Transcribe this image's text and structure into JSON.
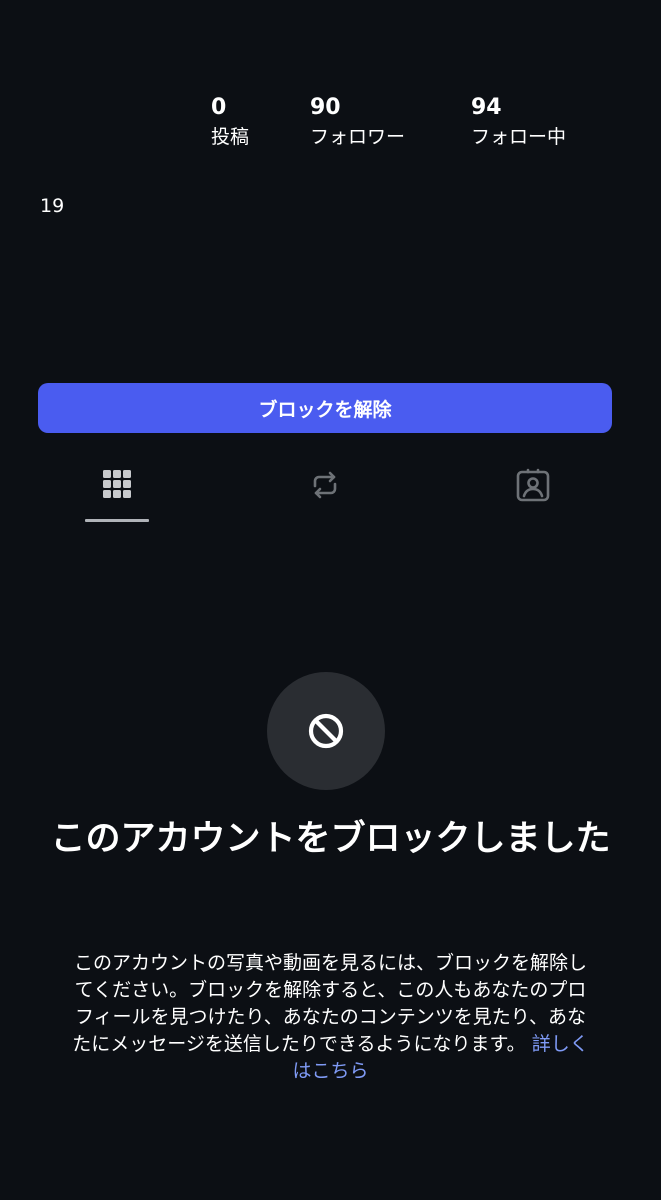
{
  "profile": {
    "stats": [
      {
        "value": "0",
        "label": "投稿"
      },
      {
        "value": "90",
        "label": "フォロワー"
      },
      {
        "value": "94",
        "label": "フォロー中"
      }
    ],
    "age": "19"
  },
  "unblock_button": {
    "label": "ブロックを解除"
  },
  "tabs": [
    {
      "icon": "grid-icon",
      "selected": true
    },
    {
      "icon": "repost-icon",
      "selected": false
    },
    {
      "icon": "tagged-person-icon",
      "selected": false
    }
  ],
  "blocked": {
    "icon": "block-icon",
    "title": "このアカウントをブロックしました",
    "description": "このアカウントの写真や動画を見るには、ブロックを解除してください。ブロックを解除すると、この人もあなたのプロフィールを見つけたり、あなたのコンテンツを見たり、あなたにメッセージを送信したりできるようになります。",
    "link": "詳しくはこちら"
  },
  "colors": {
    "background": "#0c0f14",
    "accent_button": "#4a5cf0",
    "link": "#7f9af5",
    "icon_circle": "#2a2d32"
  }
}
